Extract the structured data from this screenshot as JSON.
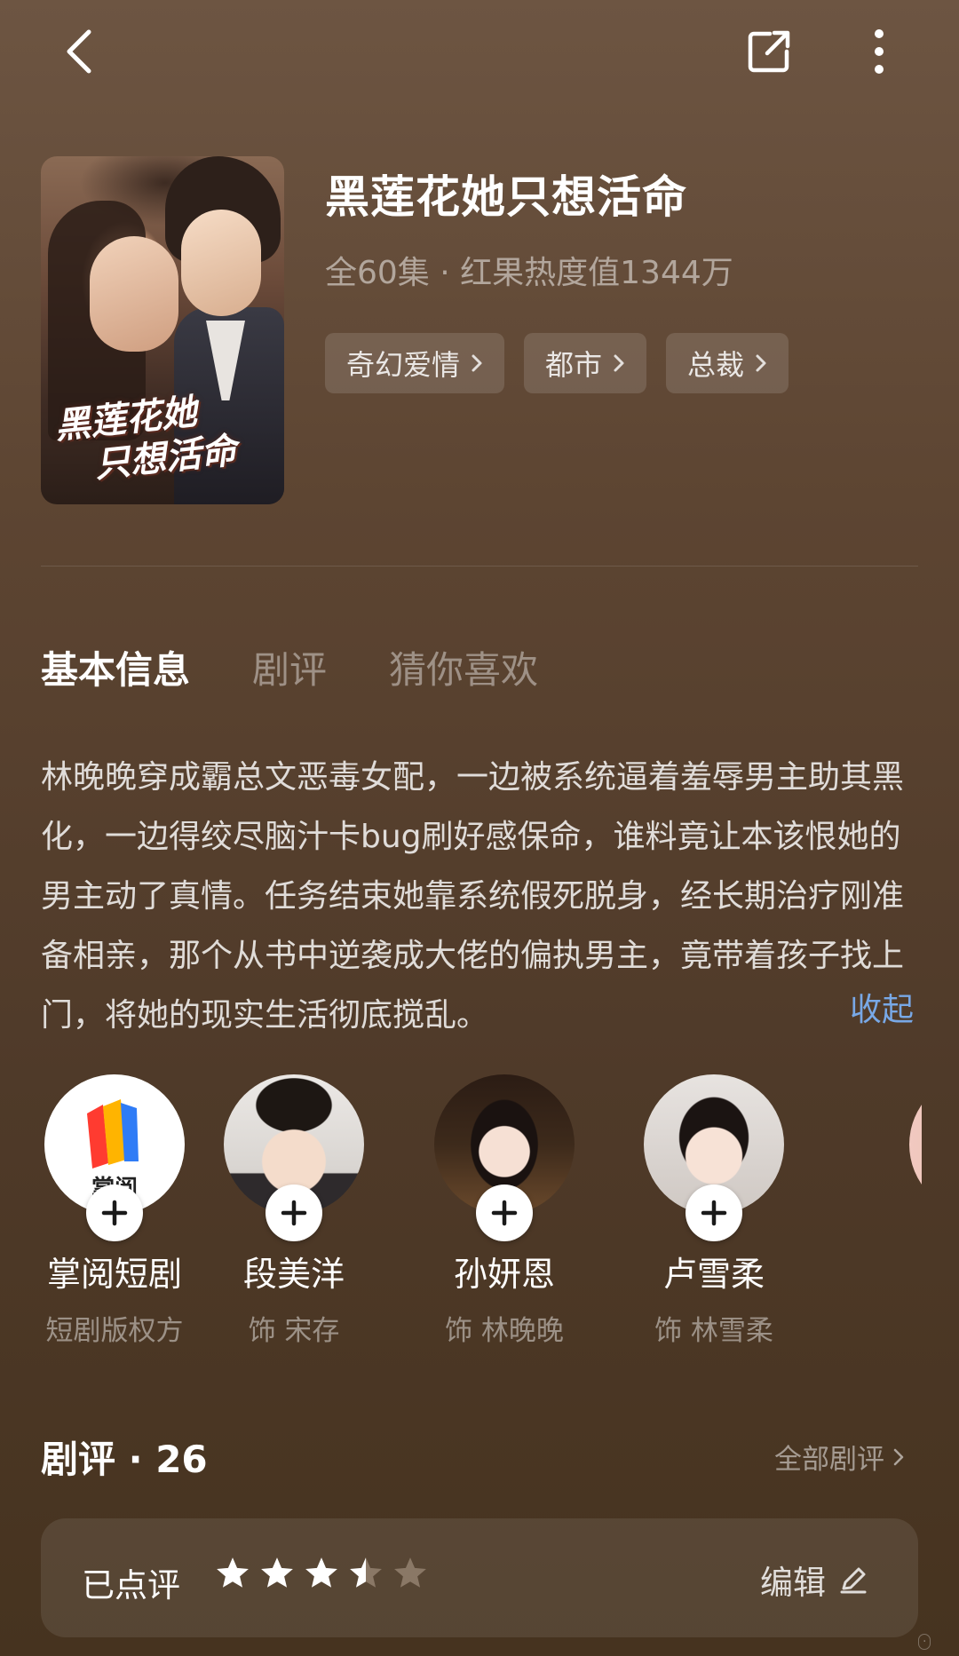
{
  "header": {
    "back_icon": "chevron-left-icon",
    "share_icon": "share-icon",
    "more_icon": "more-vertical-icon"
  },
  "drama": {
    "title": "黑莲花她只想活命",
    "meta": "全60集 · 红果热度值1344万",
    "poster_logo_line1": "黑莲花她",
    "poster_logo_line2": "只想活命",
    "tags": [
      "奇幻爱情",
      "都市",
      "总裁"
    ]
  },
  "tabs": [
    "基本信息",
    "剧评",
    "猜你喜欢"
  ],
  "synopsis": {
    "text": "林晚晚穿成霸总文恶毒女配，一边被系统逼着羞辱男主助其黑化，一边得绞尽脑汁卡bug刷好感保命，谁料竟让本该恨她的男主动了真情。任务结束她靠系统假死脱身，经长期治疗刚准备相亲，那个从书中逆袭成大佬的偏执男主，竟带着孩子找上门，将她的现实生活彻底搅乱。",
    "collapse_label": "收起"
  },
  "cast": [
    {
      "name": "掌阅短剧",
      "role": "短剧版权方",
      "avatar_text": "掌阅"
    },
    {
      "name": "段美洋",
      "role": "饰 宋存"
    },
    {
      "name": "孙妍恩",
      "role": "饰 林晚晚"
    },
    {
      "name": "卢雪柔",
      "role": "饰 林雪柔"
    }
  ],
  "reviews": {
    "title": "剧评 · 26",
    "all_label": "全部剧评",
    "rated_label": "已点评",
    "rating": 3.5,
    "rating_max": 5,
    "edit_label": "编辑"
  },
  "colors": {
    "accent_link": "#78a8e6",
    "star_filled": "#ffffff",
    "star_empty": "#8a7866"
  }
}
